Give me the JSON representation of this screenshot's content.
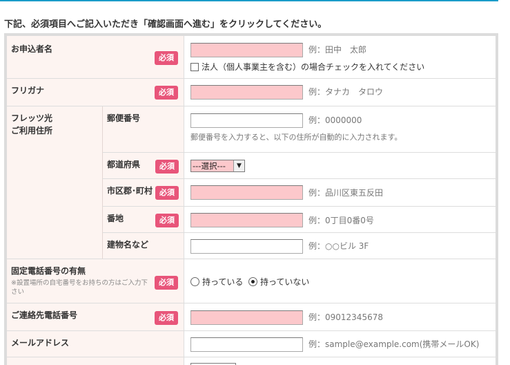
{
  "instruction": "下記、必須項目へご記入いただき「確認画面へ進む」をクリックしてください。",
  "required_badge": "必須",
  "fields": {
    "applicant_name": {
      "label": "お申込者名",
      "example": "例：田中　太郎",
      "corporate_checkbox_label": "法人（個人事業主を含む）の場合チェックを入れてください",
      "corporate_checked": false
    },
    "furigana": {
      "label": "フリガナ",
      "example": "例：タナカ　タロウ"
    },
    "address_group": {
      "label_line1": "フレッツ光",
      "label_line2": "ご利用住所",
      "postal_code": {
        "label": "郵便番号",
        "example": "例：0000000",
        "help": "郵便番号を入力すると、以下の住所が自動的に入力されます。"
      },
      "prefecture": {
        "label": "都道府県",
        "selected": "---選択---"
      },
      "city": {
        "label": "市区郡･町村",
        "example": "例：品川区東五反田"
      },
      "street": {
        "label": "番地",
        "example": "例：0丁目0番0号"
      },
      "building": {
        "label": "建物名など",
        "example": "例：○○ビル 3F"
      }
    },
    "landline": {
      "label": "固定電話番号の有無",
      "note": "※設置場所の自宅番号をお持ちの方はご入力下さい",
      "option_have": "持っている",
      "option_not_have": "持っていない",
      "selected": "持っていない"
    },
    "contact_phone": {
      "label": "ご連絡先電話番号",
      "example": "例：09012345678"
    },
    "email": {
      "label": "メールアドレス",
      "example": "例：sample@example.com(携帯メールOK)"
    }
  }
}
